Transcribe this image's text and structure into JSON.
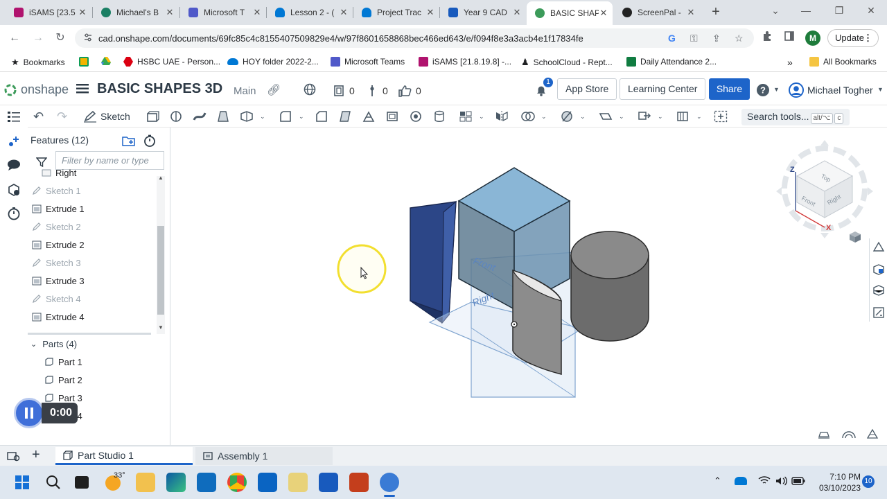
{
  "browser": {
    "tabs": [
      {
        "title": "iSAMS [23.5",
        "color": "#b0136e"
      },
      {
        "title": "Michael's B",
        "color": "#1a7f64"
      },
      {
        "title": "Microsoft T",
        "color": "#5059c9"
      },
      {
        "title": "Lesson 2 - (",
        "color": "#0078d4"
      },
      {
        "title": "Project Trac",
        "color": "#0078d4"
      },
      {
        "title": "Year 9 CAD",
        "color": "#185abd"
      },
      {
        "title": "BASIC SHAP",
        "color": "#3c9b5a"
      },
      {
        "title": "ScreenPal -",
        "color": "#222222"
      }
    ],
    "url": "cad.onshape.com/documents/69fc85c4c8155407509829e4/w/97f8601658868bec466ed643/e/f094f8e3a3acb4e1f17834fe",
    "profile_initial": "M",
    "update_label": "Update",
    "bookmarks": [
      "Bookmarks",
      "HSBC UAE - Person...",
      "HOY folder 2022-2...",
      "Microsoft Teams",
      "iSAMS [21.8.19.8] -...",
      "SchoolCloud - Rept...",
      "Daily Attendance 2..."
    ],
    "bookmarks_more": "»",
    "all_bookmarks": "All Bookmarks"
  },
  "onshape": {
    "logo_text": "onshape",
    "doc_title": "BASIC SHAPES 3D",
    "branch": "Main",
    "counts": {
      "versions": "0",
      "branches": "0",
      "likes": "0"
    },
    "notification_count": "1",
    "app_store": "App Store",
    "learning_center": "Learning Center",
    "share": "Share",
    "user_name": "Michael Togher"
  },
  "toolbar": {
    "sketch_label": "Sketch",
    "search_placeholder": "Search tools...",
    "search_shortcut_1": "alt/⌥",
    "search_shortcut_2": "c"
  },
  "features": {
    "title": "Features (12)",
    "filter_placeholder": "Filter by name or type",
    "list": [
      {
        "label": "Right",
        "kind": "plane"
      },
      {
        "label": "Sketch 1",
        "kind": "sketch"
      },
      {
        "label": "Extrude 1",
        "kind": "extrude"
      },
      {
        "label": "Sketch 2",
        "kind": "sketch"
      },
      {
        "label": "Extrude 2",
        "kind": "extrude"
      },
      {
        "label": "Sketch 3",
        "kind": "sketch"
      },
      {
        "label": "Extrude 3",
        "kind": "extrude"
      },
      {
        "label": "Sketch 4",
        "kind": "sketch"
      },
      {
        "label": "Extrude 4",
        "kind": "extrude"
      }
    ],
    "parts_title": "Parts (4)",
    "parts": [
      "Part 1",
      "Part 2",
      "Part 3",
      "Part 4"
    ]
  },
  "viewport": {
    "plane_front": "Front",
    "plane_right": "Right",
    "cube_top": "Top",
    "cube_front": "Front",
    "cube_right": "Right",
    "axis_z": "Z",
    "axis_x": "X"
  },
  "player": {
    "time": "0:00"
  },
  "bottom_tabs": [
    "Part Studio 1",
    "Assembly 1"
  ],
  "taskbar": {
    "weather": "33°",
    "time": "7:10 PM",
    "date": "03/10/2023",
    "notif_count": "10"
  }
}
